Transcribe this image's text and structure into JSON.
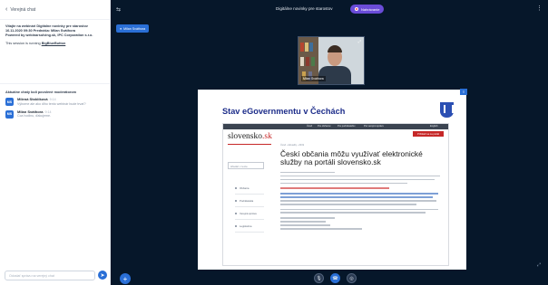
{
  "chat": {
    "header_label": "Verejná chat",
    "welcome_line1": "Vitajte na webinári Digitálne novinky pre starostov",
    "welcome_line2": "16.11.2020 09:30 Prednáša: Milan Sváthora",
    "welcome_line3": "Powered by webinarsolving.sk, IPC Corporation s.r.o.",
    "recording_prefix": "This session is running",
    "recording_link": "BigBlueButton",
    "section_label": "Aktuálne chaty boli povolené moderátorom",
    "messages": [
      {
        "initials": "MS",
        "name": "Milená Stoklíková",
        "time": "9:14",
        "text": "Výborne ale ako dlho tento webinár bude trvať?"
      },
      {
        "initials": "MS",
        "name": "Milan Sváthora",
        "time": "9:14",
        "text": "Cca hodinu, ďakujeme."
      }
    ],
    "compose_placeholder": "Odoslať správu na verejný chat"
  },
  "meeting": {
    "title": "Digitálne novinky pre starostov",
    "recording_label": "Nahrávanie",
    "talking_label": "Milan Sváthora",
    "webcam_name": "Milan Sváthora"
  },
  "slide": {
    "title": "Stav eGovernmentu v Čechách",
    "site_logo": "slovensko",
    "site_logo_tld": ".sk",
    "nav_items": [
      "Úvod",
      "Pre občanov",
      "Pre podnikateľov",
      "Pre verejnú správu",
      "English"
    ],
    "red_button": "Prihlásiť sa na portál",
    "search_placeholder": "Hľadať v texte",
    "menu_items": [
      "Občania",
      "Podnikatelia",
      "Verejná správa",
      "Legislatíva"
    ],
    "breadcrumb": "Úvod › Aktuality › 2019",
    "article_title": "Českí občania môžu využívať elektronické služby na portáli slovensko.sk"
  },
  "controls": {
    "mic": "🎙",
    "audio": "☎",
    "camera": "◎"
  }
}
